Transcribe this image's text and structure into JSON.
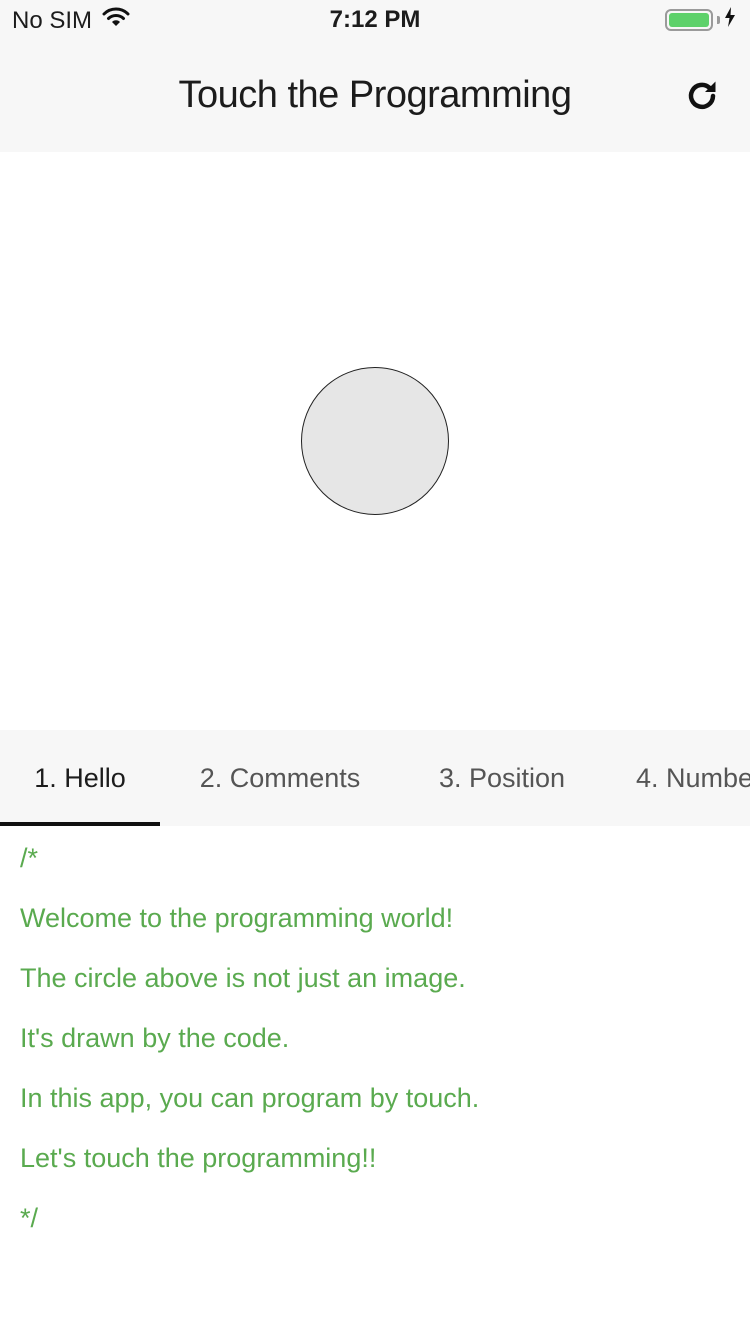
{
  "status": {
    "carrier": "No SIM",
    "time": "7:12 PM"
  },
  "nav": {
    "title": "Touch the Programming",
    "refresh_icon": "refresh-icon"
  },
  "tabs": [
    {
      "label": "1. Hello",
      "active": true
    },
    {
      "label": "2. Comments",
      "active": false
    },
    {
      "label": "3. Position",
      "active": false
    },
    {
      "label": "4. Numbe",
      "active": false
    }
  ],
  "code": {
    "lines": [
      "/*",
      "Welcome to the programming world!",
      "The circle above is not just an image.",
      "It's drawn by the code.",
      "In this app, you can program by touch.",
      "Let's touch the programming!!",
      "*/"
    ],
    "comment_color": "#5aaa4f"
  },
  "colors": {
    "battery": "#5dd16a",
    "circle_fill": "#e6e6e6"
  }
}
